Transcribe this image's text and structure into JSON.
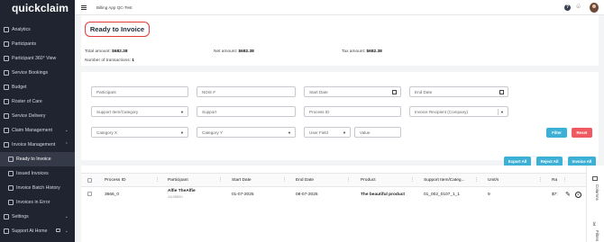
{
  "app": {
    "logo": "quickclaim",
    "breadcrumb": "Billing App QC-Test"
  },
  "sidebar": {
    "items": [
      {
        "label": "Analytics"
      },
      {
        "label": "Participants"
      },
      {
        "label": "Participant 360° View"
      },
      {
        "label": "Service Bookings"
      },
      {
        "label": "Budget"
      },
      {
        "label": "Roster of Care"
      },
      {
        "label": "Service Delivery"
      },
      {
        "label": "Claim Management"
      },
      {
        "label": "Invoice Management"
      },
      {
        "label": "Ready to Invoice"
      },
      {
        "label": "Issued Invoices"
      },
      {
        "label": "Invoice Batch History"
      },
      {
        "label": "Invoices in Error"
      },
      {
        "label": "Settings"
      },
      {
        "label": "Support At Home"
      }
    ]
  },
  "page": {
    "title": "Ready to Invoice"
  },
  "summary": {
    "total_label": "Total amount:",
    "total_value": "$682.38",
    "net_label": "Net amount:",
    "net_value": "$682.38",
    "tax_label": "Tax amount:",
    "tax_value": "$682.38",
    "count_label": "Number of transactions:",
    "count_value": "1"
  },
  "filters": {
    "participant": "Participant",
    "ndis": "NDIS #",
    "start_date": "Start Date",
    "end_date": "End Date",
    "support_item_category": "Support Item/Category",
    "support": "Support",
    "process_id": "Process ID",
    "invoice_recipient": "Invoice Recipient (Company)",
    "category_x": "Category X",
    "category_y": "Category Y",
    "user_field": "User Field",
    "value": "Value",
    "filter_btn": "Filter",
    "reset_btn": "Reset"
  },
  "actions": {
    "export_all": "Export All",
    "reject_all": "Reject All",
    "invoice_all": "Invoice All"
  },
  "table": {
    "columns": [
      "Process ID",
      "Participant",
      "Start Date",
      "End Date",
      "Product",
      "Support Item/Categ...",
      "Unit/s",
      "Ra"
    ],
    "row": {
      "process_id": "3666_0",
      "participant": "Alfie TheAlfie",
      "participant_sub": "431288891",
      "start": "01-07-2025",
      "end": "08-07-2025",
      "product": "The beautiful product",
      "support_item": "01_002_0107_1_1",
      "units": "9",
      "rate": "$7:"
    }
  },
  "side_tabs": {
    "columns": "Columns",
    "filters": "Filters"
  }
}
